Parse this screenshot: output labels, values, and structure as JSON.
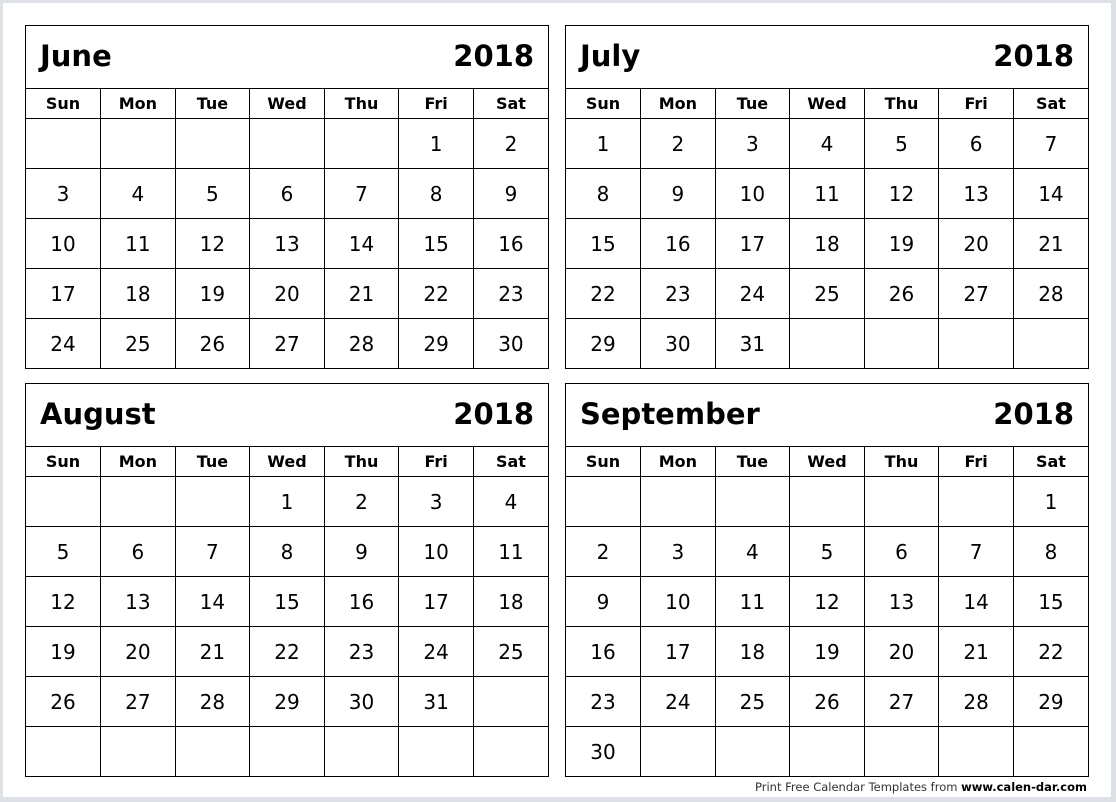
{
  "weekdays": [
    "Sun",
    "Mon",
    "Tue",
    "Wed",
    "Thu",
    "Fri",
    "Sat"
  ],
  "calendars": [
    {
      "month": "June",
      "year": "2018",
      "weeks": [
        [
          "",
          "",
          "",
          "",
          "",
          "1",
          "2"
        ],
        [
          "3",
          "4",
          "5",
          "6",
          "7",
          "8",
          "9"
        ],
        [
          "10",
          "11",
          "12",
          "13",
          "14",
          "15",
          "16"
        ],
        [
          "17",
          "18",
          "19",
          "20",
          "21",
          "22",
          "23"
        ],
        [
          "24",
          "25",
          "26",
          "27",
          "28",
          "29",
          "30"
        ]
      ]
    },
    {
      "month": "July",
      "year": "2018",
      "weeks": [
        [
          "1",
          "2",
          "3",
          "4",
          "5",
          "6",
          "7"
        ],
        [
          "8",
          "9",
          "10",
          "11",
          "12",
          "13",
          "14"
        ],
        [
          "15",
          "16",
          "17",
          "18",
          "19",
          "20",
          "21"
        ],
        [
          "22",
          "23",
          "24",
          "25",
          "26",
          "27",
          "28"
        ],
        [
          "29",
          "30",
          "31",
          "",
          "",
          "",
          ""
        ]
      ]
    },
    {
      "month": "August",
      "year": "2018",
      "weeks": [
        [
          "",
          "",
          "",
          "1",
          "2",
          "3",
          "4"
        ],
        [
          "5",
          "6",
          "7",
          "8",
          "9",
          "10",
          "11"
        ],
        [
          "12",
          "13",
          "14",
          "15",
          "16",
          "17",
          "18"
        ],
        [
          "19",
          "20",
          "21",
          "22",
          "23",
          "24",
          "25"
        ],
        [
          "26",
          "27",
          "28",
          "29",
          "30",
          "31",
          ""
        ],
        [
          "",
          "",
          "",
          "",
          "",
          "",
          ""
        ]
      ]
    },
    {
      "month": "September",
      "year": "2018",
      "weeks": [
        [
          "",
          "",
          "",
          "",
          "",
          "",
          "1"
        ],
        [
          "2",
          "3",
          "4",
          "5",
          "6",
          "7",
          "8"
        ],
        [
          "9",
          "10",
          "11",
          "12",
          "13",
          "14",
          "15"
        ],
        [
          "16",
          "17",
          "18",
          "19",
          "20",
          "21",
          "22"
        ],
        [
          "23",
          "24",
          "25",
          "26",
          "27",
          "28",
          "29"
        ],
        [
          "30",
          "",
          "",
          "",
          "",
          "",
          ""
        ]
      ]
    }
  ],
  "footer": {
    "text": "Print Free Calendar Templates from ",
    "link": "www.calen-dar.com"
  }
}
